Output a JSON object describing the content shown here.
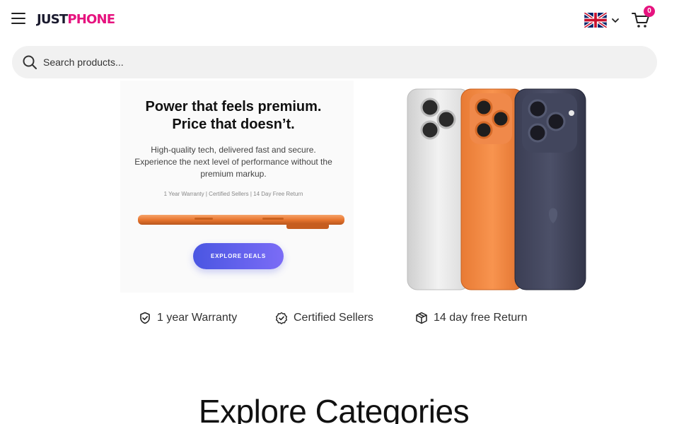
{
  "header": {
    "logo_just": "JUST",
    "logo_phone": "PHONE",
    "cart_count": "0"
  },
  "search": {
    "placeholder": "Search products..."
  },
  "hero": {
    "title_line1": "Power that feels premium.",
    "title_line2": "Price that doesn’t.",
    "subtitle_line1": "High-quality tech, delivered fast and secure.",
    "subtitle_line2": "Experience the next level of performance without the",
    "subtitle_line3": "premium markup.",
    "badges": "1 Year Warranty | Certified Sellers | 14 Day Free Return",
    "cta_label": "EXPLORE DEALS"
  },
  "features": [
    {
      "label": "1 year Warranty",
      "icon": "shield-check-icon"
    },
    {
      "label": "Certified Sellers",
      "icon": "badge-check-icon"
    },
    {
      "label": "14 day free Return",
      "icon": "box-icon"
    }
  ],
  "categories": {
    "title": "Explore Categories"
  },
  "colors": {
    "brand_pink": "#e6137f",
    "brand_dark": "#1a1a2e",
    "cta_start": "#4a56e2",
    "cta_end": "#7b6cf6"
  }
}
